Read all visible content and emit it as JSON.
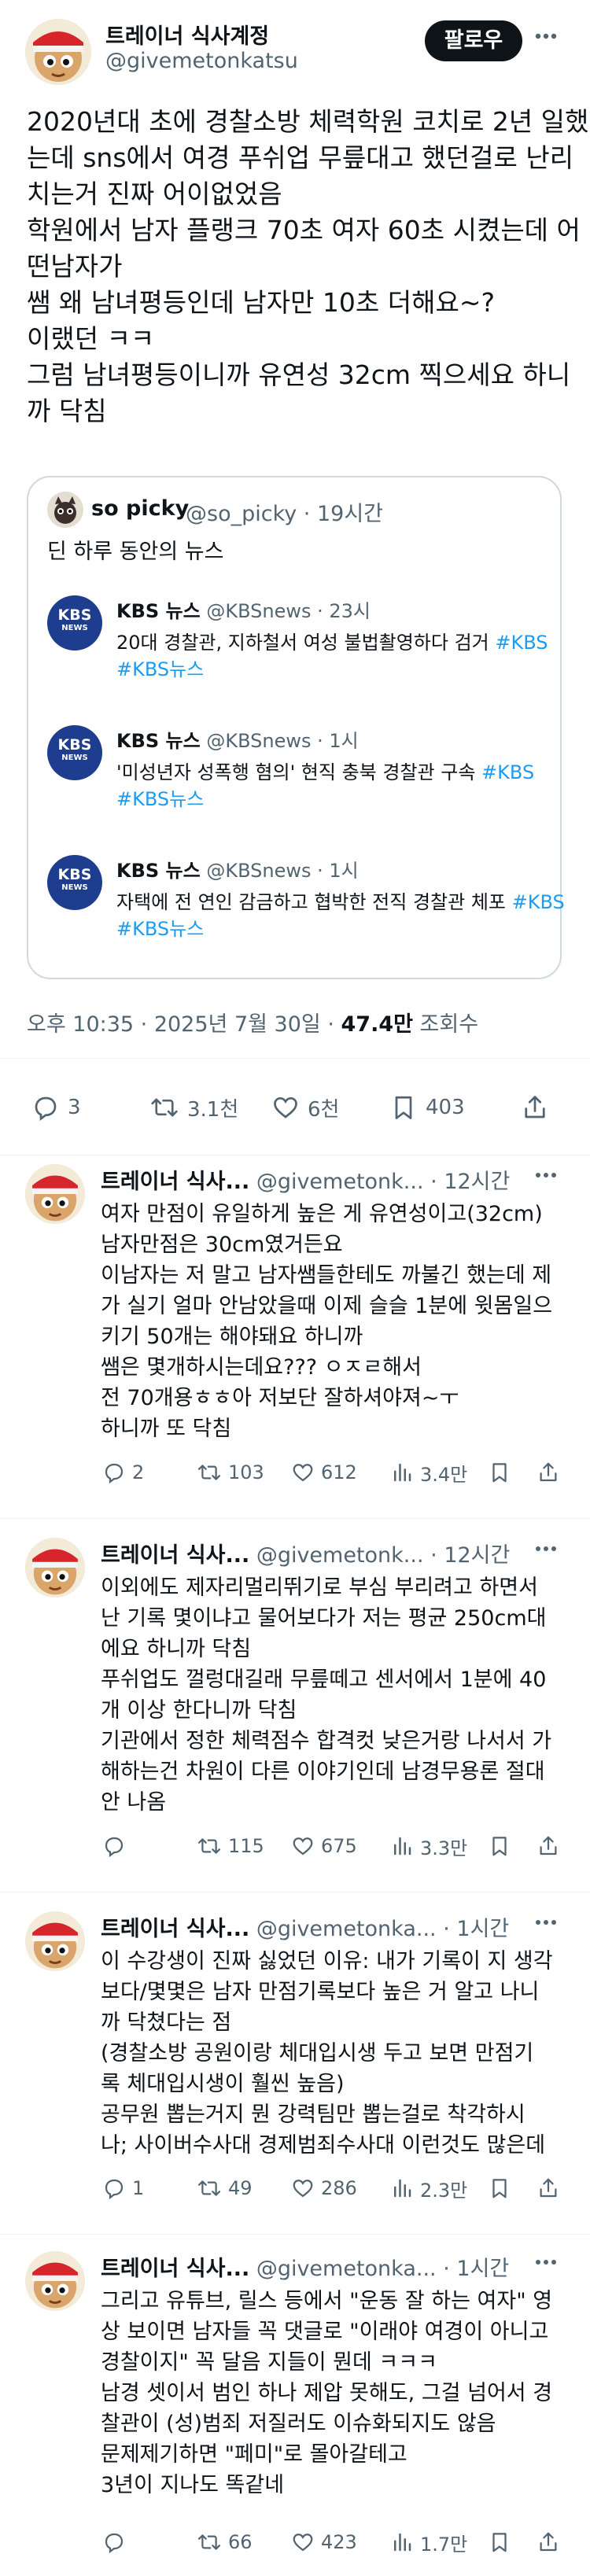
{
  "main_tweet": {
    "author_name": "트레이너 식사계정",
    "author_handle": "@givemetonkatsu",
    "follow_label": "팔로우",
    "body_lines": [
      "2020년대 초에 경찰소방 체력학원 코치로 2년 일했",
      "는데 sns에서 여경 푸쉬업 무릎대고 했던걸로 난리",
      "치는거 진짜 어이없었음",
      "학원에서 남자 플랭크 70초 여자 60초 시켰는데 어",
      "떤남자가",
      "쌤 왜 남녀평등인데 남자만 10초 더해요~?",
      "이랬던 ㅋㅋ",
      "그럼 남녀평등이니까 유연성 32cm 찍으세요 하니",
      "까 닥침"
    ],
    "quote": {
      "author_name": "so picky",
      "author_handle": "@so_picky · 19시간",
      "text": "딘 하루 동안의 뉴스",
      "news": [
        {
          "name": "KBS 뉴스",
          "handle": "@KBSnews · 23시",
          "line1": "20대 경찰관, 지하철서 여성 불법촬영하다 검거",
          "line1_tag": " #KBS",
          "line2_tag": "#KBS뉴스"
        },
        {
          "name": "KBS 뉴스",
          "handle": "@KBSnews · 1시",
          "line1": "'미성년자 성폭행 혐의' 현직 충북 경찰관 구속",
          "line1_tag": " #KBS",
          "line2_tag": "#KBS뉴스"
        },
        {
          "name": "KBS 뉴스",
          "handle": "@KBSnews · 1시",
          "line1": "자택에 전 연인 감금하고 협박한 전직 경찰관 체포",
          "line1_tag": " #KBS",
          "line2_tag": "#KBS뉴스"
        }
      ]
    },
    "meta_time": "오후 10:35 · 2025년 7월 30일 · ",
    "meta_views": "47.4만",
    "meta_views_label": " 조회수",
    "stats": {
      "replies": "3",
      "retweets": "3.1천",
      "likes": "6천",
      "bookmarks": "403"
    }
  },
  "replies": [
    {
      "name": "트레이너 식사...",
      "handle": "@givemetonk...",
      "time": "· 12시간",
      "lines": [
        "여자 만점이 유일하게 높은 게 유연성이고(32cm)",
        "남자만점은 30cm였거든요",
        "이남자는 저 말고 남자쌤들한테도 까불긴 했는데 제",
        "가 실기 얼마 안남았을때 이제 슬슬 1분에 윗몸일으",
        "키기 50개는 해야돼요 하니까",
        "쌤은 몇개하시는데요??? ㅇㅈㄹ해서",
        "전 70개용ㅎㅎ아 저보단 잘하셔야져~ㅜ",
        "하니까 또 닥침"
      ],
      "stats": {
        "replies": "2",
        "retweets": "103",
        "likes": "612",
        "views": "3.4만"
      }
    },
    {
      "name": "트레이너 식사...",
      "handle": "@givemetonk...",
      "time": "· 12시간",
      "lines": [
        "이외에도 제자리멀리뛰기로 부심 부리려고 하면서",
        "난 기록 몇이냐고 물어보다가 저는 평균 250cm대",
        "에요 하니까 닥침",
        "푸쉬업도 껄렁대길래 무릎떼고 센서에서 1분에 40",
        "개 이상 한다니까 닥침",
        "기관에서 정한 체력점수 합격컷 낮은거랑 나서서 가",
        "해하는건 차원이 다른 이야기인데 남경무용론 절대",
        "안 나옴"
      ],
      "stats": {
        "replies": "",
        "retweets": "115",
        "likes": "675",
        "views": "3.3만"
      }
    },
    {
      "name": "트레이너 식사...",
      "handle": "@givemetonka...",
      "time": "· 1시간",
      "lines": [
        "이 수강생이 진짜 싫었던 이유: 내가 기록이 지 생각",
        "보다/몇몇은 남자 만점기록보다 높은 거 알고 나니",
        "까 닥쳤다는 점",
        "(경찰소방 공원이랑 체대입시생 두고 보면 만점기",
        "록 체대입시생이 훨씬 높음)",
        "공무원 뽑는거지 뭔 강력팀만 뽑는걸로 착각하시",
        "나; 사이버수사대 경제범죄수사대 이런것도 많은데"
      ],
      "stats": {
        "replies": "1",
        "retweets": "49",
        "likes": "286",
        "views": "2.3만"
      }
    },
    {
      "name": "트레이너 식사...",
      "handle": "@givemetonka...",
      "time": "· 1시간",
      "lines": [
        "그리고 유튜브, 릴스 등에서 \"운동 잘 하는 여자\" 영",
        "상 보이면 남자들 꼭 댓글로 \"이래야 여경이 아니고",
        "경찰이지\" 꼭 달음 지들이 뭔데 ㅋㅋㅋ",
        "남경 셋이서 범인 하나 제압 못해도, 그걸 넘어서 경",
        "찰관이 (성)범죄 저질러도 이슈화되지도 않음",
        "문제제기하면 \"페미\"로 몰아갈테고",
        "3년이 지나도 똑같네"
      ],
      "stats": {
        "replies": "",
        "retweets": "66",
        "likes": "423",
        "views": "1.7만"
      }
    }
  ],
  "icons": {
    "reply": "reply-icon",
    "retweet": "retweet-icon",
    "like": "heart-icon",
    "views": "views-icon",
    "bookmark": "bookmark-icon",
    "share": "share-icon",
    "more": "more-icon"
  },
  "colors": {
    "text": "#0f1419",
    "secondary": "#536471",
    "link": "#1d9bf0",
    "border": "#cfd9de",
    "kbs": "#1e3d8f",
    "follow_bg": "#0f1419"
  }
}
